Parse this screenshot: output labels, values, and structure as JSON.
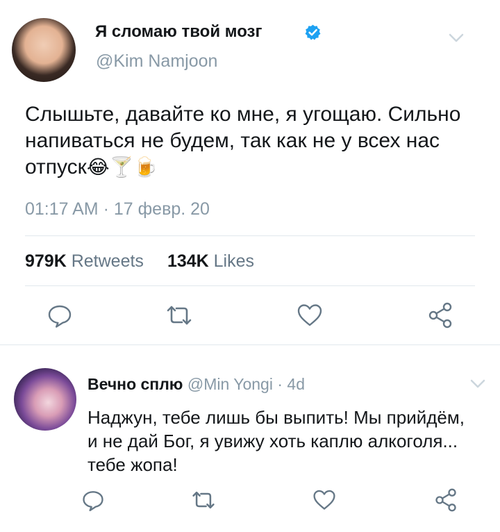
{
  "tweet": {
    "author_name": "Я сломаю твой мозг",
    "author_handle": "@Kim Namjoon",
    "text": "Слышьте, давайте ко мне, я угощаю. Сильно напиваться не будем, так как не у всех нас отпуск",
    "emojis": "😂🍸🍺",
    "timestamp": "01:17 AM · 17 февр. 20",
    "retweets_count": "979K",
    "retweets_label": "Retweets",
    "likes_count": "134K",
    "likes_label": "Likes"
  },
  "reply": {
    "author_name": "Вечно сплю",
    "author_handle": "@Min Yongi",
    "separator": "·",
    "age": "4d",
    "text": "Наджун, тебе лишь бы выпить! Мы прийдём, и не дай Бог, я увижу хоть каплю алкоголя... тебе жопа!"
  },
  "icons": {
    "verified": "verified-badge-icon",
    "menu": "chevron-down-icon",
    "reply": "reply-icon",
    "retweet": "retweet-icon",
    "like": "heart-icon",
    "share": "share-icon"
  },
  "colors": {
    "verified": "#1da1f2",
    "muted": "#8899a6",
    "icon": "#657786",
    "text": "#14171a",
    "divider": "#e1e8ed"
  }
}
